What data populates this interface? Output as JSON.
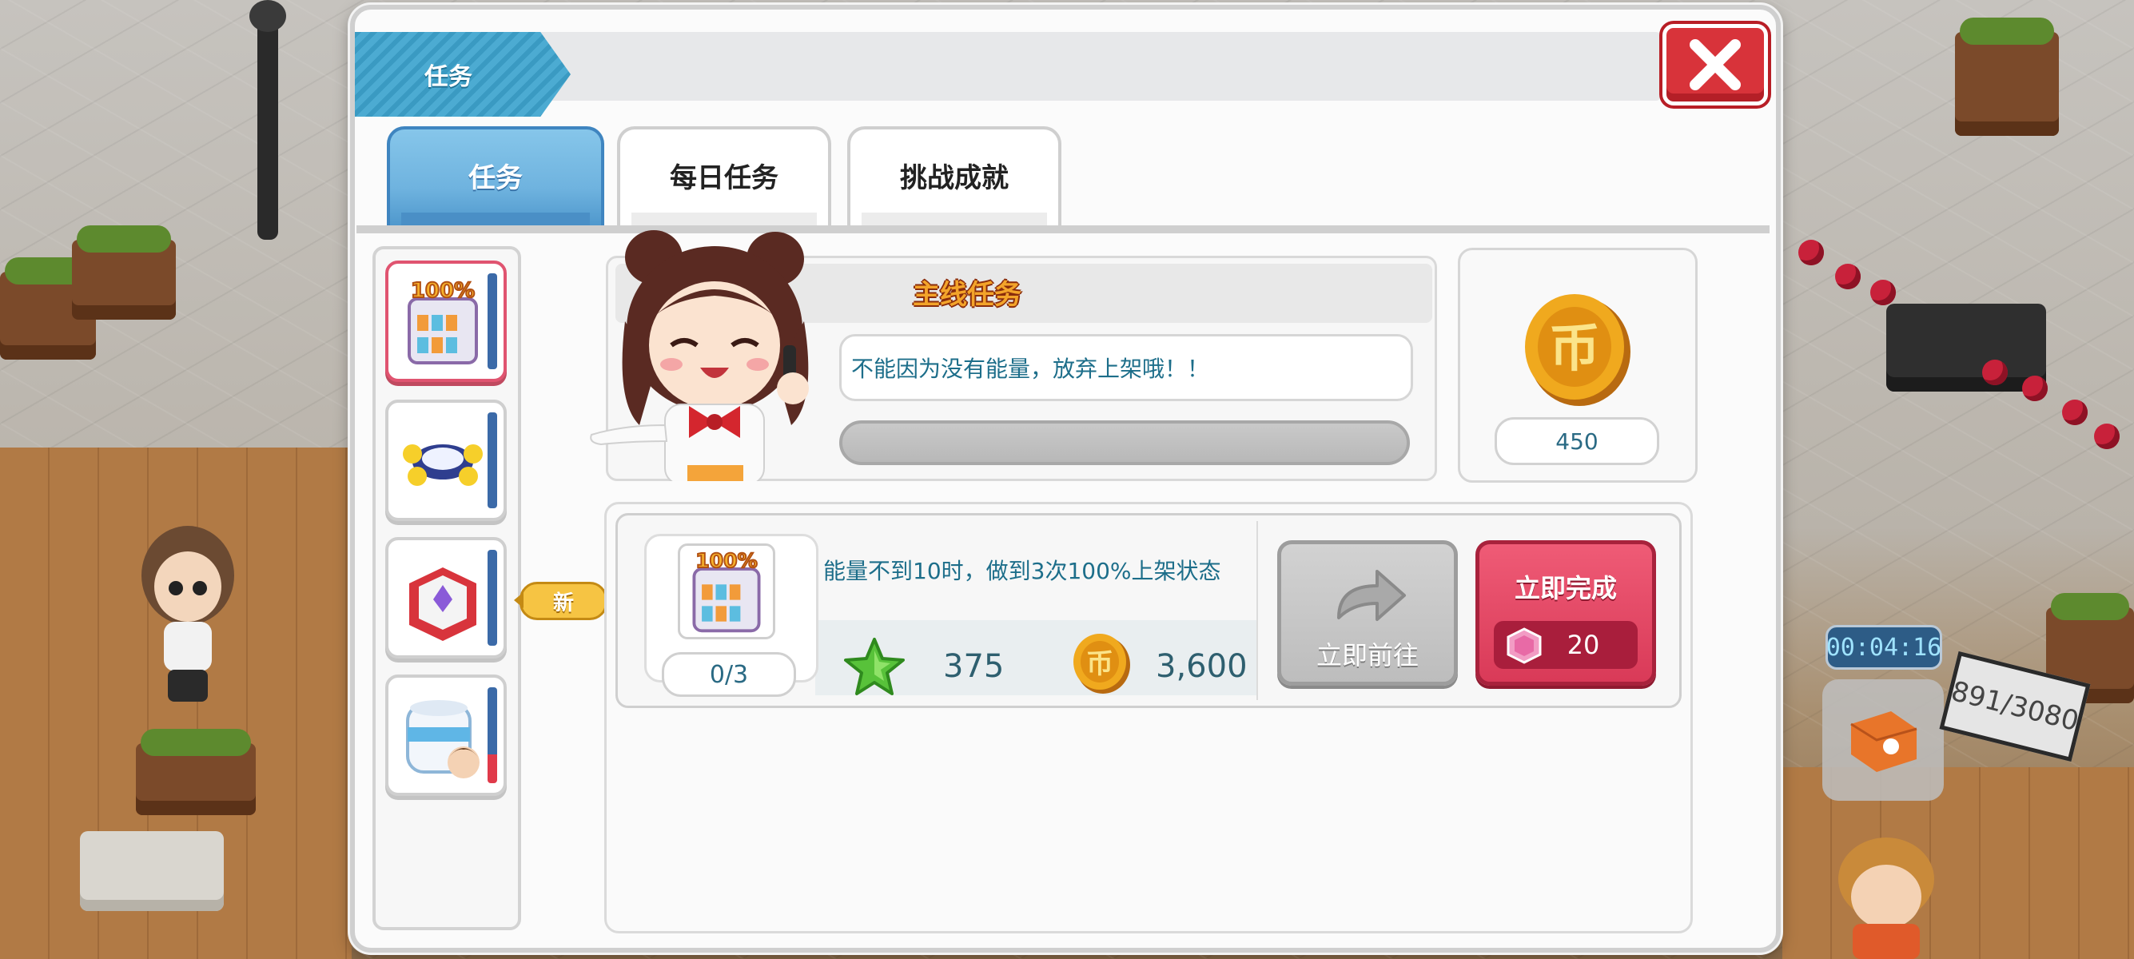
{
  "window": {
    "title": "任务",
    "close_icon": "close-icon"
  },
  "tabs": [
    {
      "label": "任务",
      "active": true
    },
    {
      "label": "每日任务",
      "active": false
    },
    {
      "label": "挑战成就",
      "active": false
    }
  ],
  "categories": [
    {
      "icon": "shelf-100-percent-icon",
      "selected": true
    },
    {
      "icon": "display-stand-icon",
      "selected": false
    },
    {
      "icon": "gift-box-icon",
      "selected": false,
      "badge": "新"
    },
    {
      "icon": "tissue-roll-customer-icon",
      "selected": false
    }
  ],
  "main_task": {
    "title": "主线任务",
    "description": "不能因为没有能量，放弃上架哦！！",
    "progress": 0
  },
  "main_reward": {
    "icon": "coin-icon",
    "amount": "450"
  },
  "task": {
    "icon": "shelf-100-percent-icon",
    "description": "能量不到10时，做到3次100%上架状态",
    "count": "0/3",
    "reward_exp": "375",
    "reward_exp_icon": "green-star-icon",
    "reward_coin": "3,600",
    "reward_coin_icon": "coin-icon"
  },
  "buttons": {
    "go": "立即前往",
    "finish": "立即完成",
    "finish_cost": "20",
    "finish_cost_icon": "pink-gem-icon"
  },
  "hud": {
    "timer": "00:04:16",
    "counter_sign": "891/3080"
  },
  "colors": {
    "accent_blue": "#4cabd2",
    "close_red": "#d8333a",
    "finish_red": "#d93a58",
    "text_teal": "#1d6e8a"
  }
}
